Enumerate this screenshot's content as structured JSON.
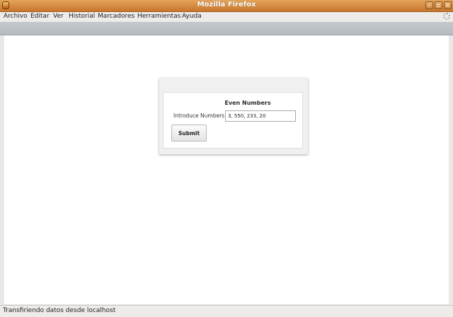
{
  "window": {
    "title": "Mozilla Firefox",
    "controls": {
      "minimize": "–",
      "maximize": "▫",
      "close": "×"
    }
  },
  "menu": {
    "items": [
      "Archivo",
      "Editar",
      "Ver",
      "Historial",
      "Marcadores",
      "Herramientas",
      "Ayuda"
    ]
  },
  "form": {
    "title": "Even Numbers",
    "label": "Introduce Numbers",
    "input_value": "3, 550, 233, 20",
    "submit_label": "Submit"
  },
  "status": {
    "text": "Transfiriendo datos desde localhost"
  },
  "colors": {
    "titlebar": "#c8762c",
    "menubar": "#edece9",
    "content_background": "#ffffff"
  }
}
